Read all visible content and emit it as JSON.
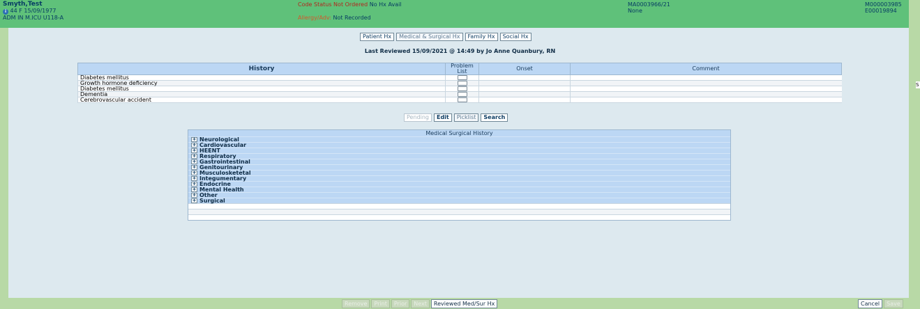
{
  "header": {
    "patient_name": "Smyth,Test",
    "info_icon": "info-icon",
    "demographics": "44  F  15/09/1977",
    "location": "ADM IN  M.ICU  U118-A",
    "code_status_label": "Code Status Not Ordered",
    "code_status_value": "No Hx Avail",
    "allergy_label": "Allergy/Adv:",
    "allergy_value": "Not Recorded",
    "account_number": "MA0003966/21",
    "account_note": "None",
    "mrn": "M000003985",
    "encounter": "E00019894"
  },
  "right_strip_text": "S",
  "tabs": [
    {
      "label": "Patient Hx"
    },
    {
      "label": "Medical & Surgical Hx"
    },
    {
      "label": "Family Hx"
    },
    {
      "label": "Social Hx"
    }
  ],
  "last_reviewed": "Last Reviewed 15/09/2021 @ 14:49 by Jo Anne Quanbury, RN",
  "history_table": {
    "columns": {
      "history": "History",
      "problem_list": "Problem List",
      "onset": "Onset",
      "comment": "Comment"
    },
    "rows": [
      {
        "history": "Diabetes mellitus",
        "onset": "",
        "comment": ""
      },
      {
        "history": "Growth hormone deficiency",
        "onset": "",
        "comment": ""
      },
      {
        "history": "Diabetes mellitus",
        "onset": "",
        "comment": ""
      },
      {
        "history": "Dementia",
        "onset": "",
        "comment": ""
      },
      {
        "history": "Cerebrovascular accident",
        "onset": "",
        "comment": ""
      }
    ]
  },
  "actions": {
    "pending": "Pending",
    "edit": "Edit",
    "picklist": "Picklist",
    "search": "Search"
  },
  "medical_surgical": {
    "title": "Medical Surgical History",
    "expand_glyph": "+",
    "items": [
      "Neurological",
      "Cardiovascular",
      "HEENT",
      "Respiratory",
      "Gastrointestinal",
      "Genitourinary",
      "Musculosketetal",
      "Integumentary",
      "Endocrine",
      "Mental Health",
      "Other",
      "Surgical"
    ]
  },
  "footer": {
    "remove": "Remove",
    "print": "Print",
    "prior": "Prior",
    "next": "Next",
    "reviewed": "Reviewed Med/Sur Hx",
    "cancel": "Cancel",
    "save": "Save"
  },
  "colors": {
    "header_green": "#5fc17a",
    "panel_bg": "#dde9ef",
    "table_header_blue": "#bcd7f4",
    "code_status_red": "#b3261e"
  }
}
